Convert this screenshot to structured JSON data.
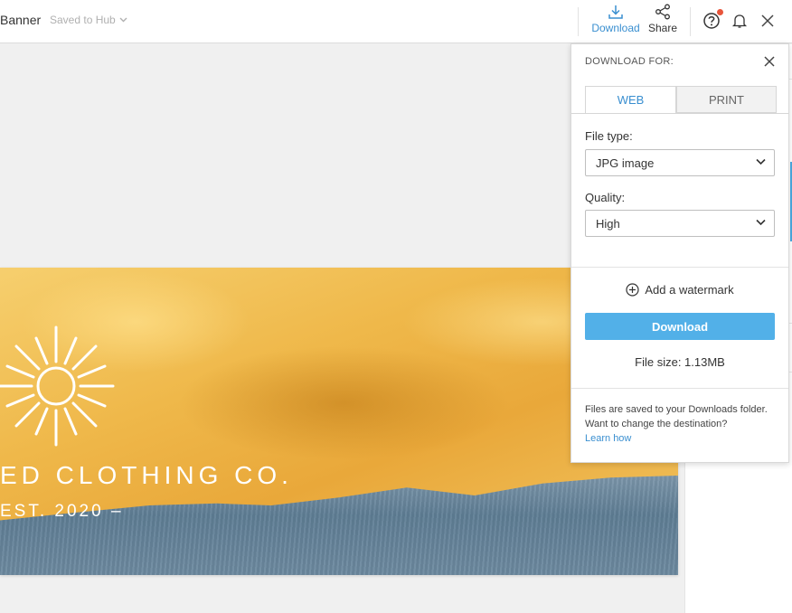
{
  "header": {
    "doc_title": "Banner",
    "saved_status": "Saved to Hub",
    "download_label": "Download",
    "share_label": "Share"
  },
  "banner": {
    "brand_text": "ED CLOTHING CO.",
    "est_text": "EST. 2020 –"
  },
  "panel": {
    "heading": "DOWNLOAD FOR:",
    "tabs": [
      {
        "label": "WEB",
        "active": true
      },
      {
        "label": "PRINT",
        "active": false
      }
    ],
    "file_type_label": "File type:",
    "file_type_value": "JPG image",
    "quality_label": "Quality:",
    "quality_value": "High",
    "watermark_label": "Add a watermark",
    "download_button": "Download",
    "file_size": "File size: 1.13MB",
    "info_text": "Files are saved to your Downloads folder. Want to change the destination?",
    "info_link": "Learn how"
  },
  "colors": {
    "accent": "#3a8fd0",
    "button": "#52b0e8",
    "notification": "#e8553b"
  },
  "icons": [
    "download-icon",
    "share-icon",
    "help-icon",
    "bell-icon",
    "close-icon",
    "chevron-down-icon",
    "plus-circle-icon",
    "sun-logo"
  ]
}
